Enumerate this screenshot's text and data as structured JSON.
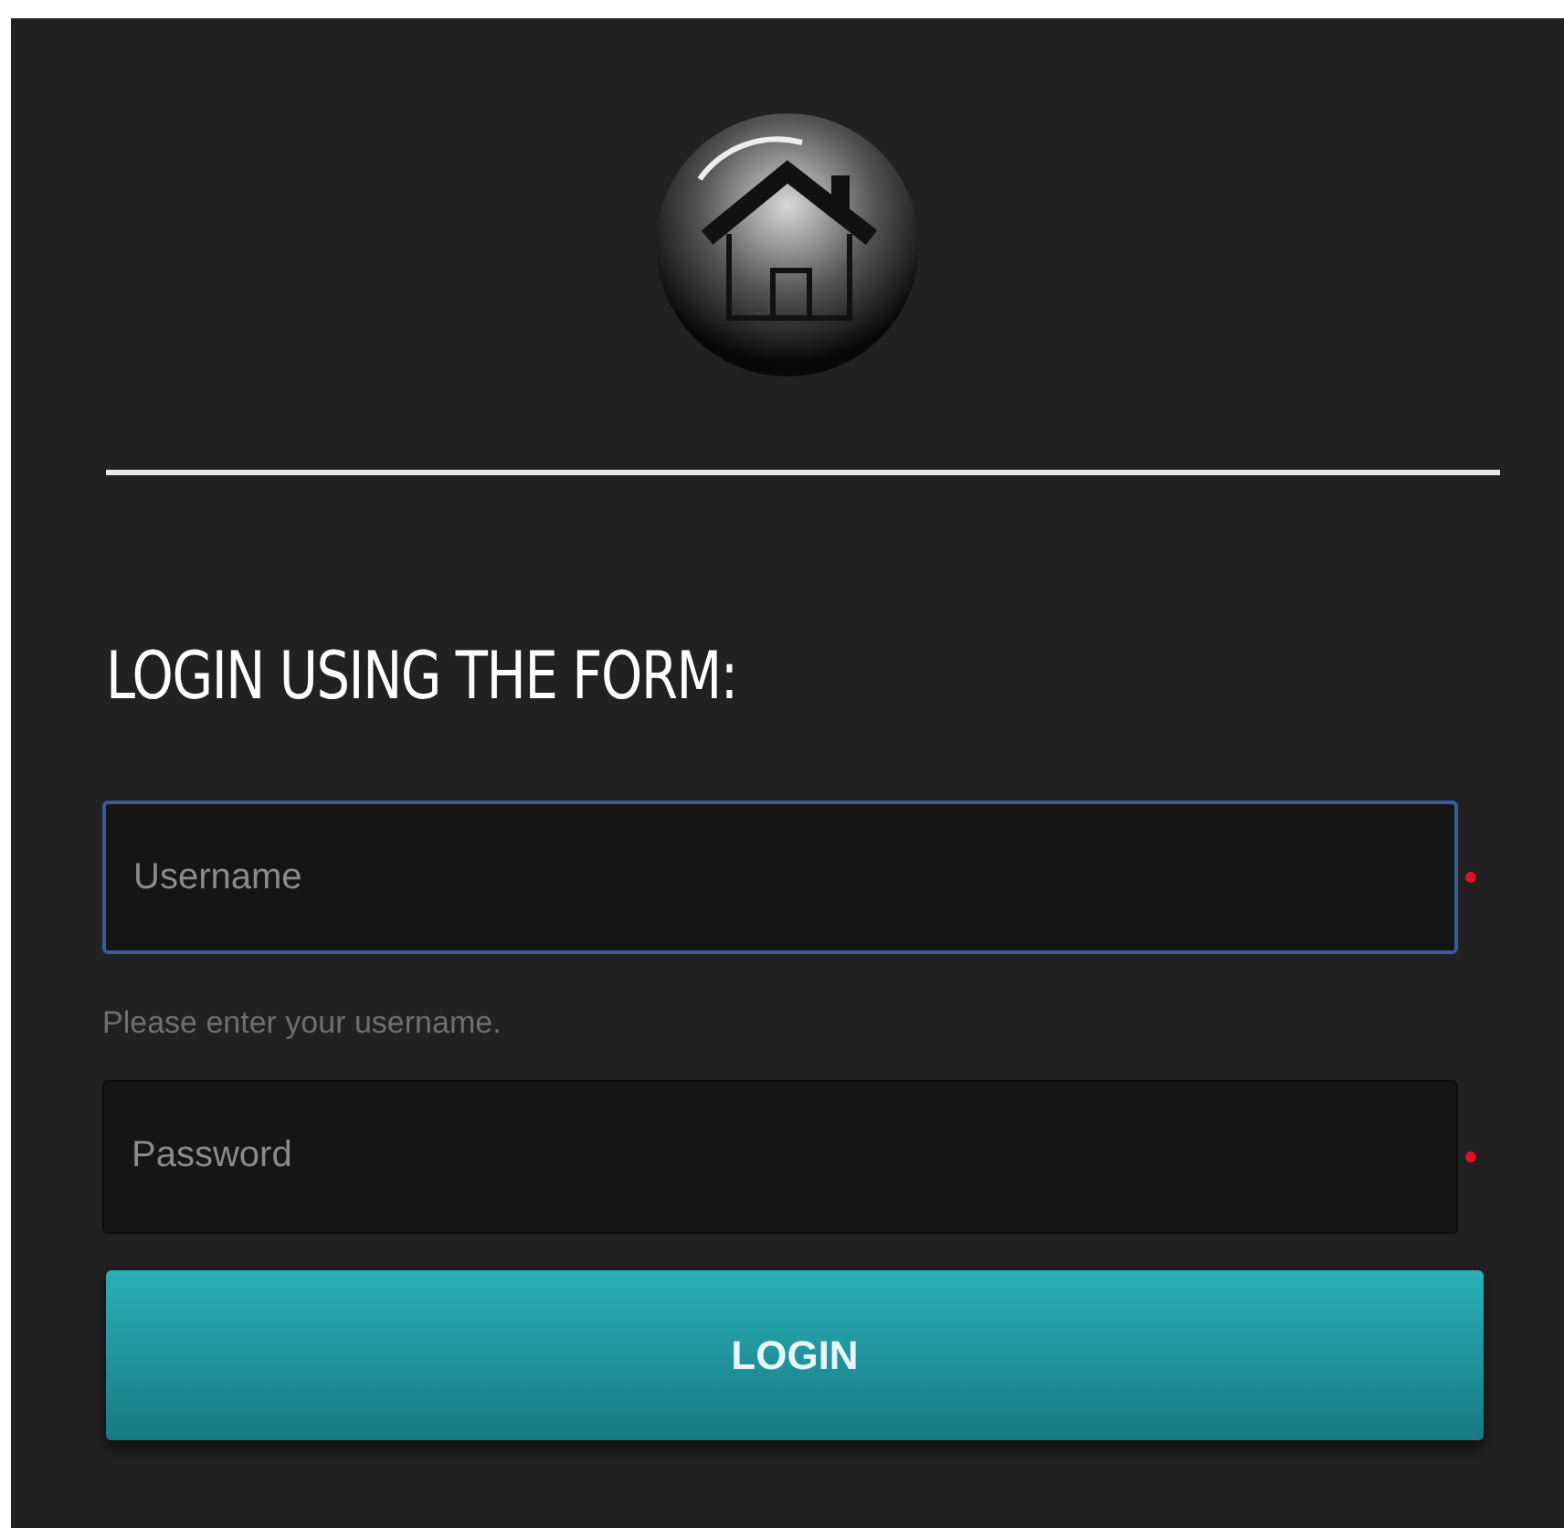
{
  "heading": "LOGIN USING THE FORM:",
  "fields": [
    {
      "placeholder": "Username",
      "focused": true,
      "required": true,
      "hint": "Please enter your username."
    },
    {
      "placeholder": "Password",
      "focused": false,
      "required": true
    }
  ],
  "button": "LOGIN"
}
